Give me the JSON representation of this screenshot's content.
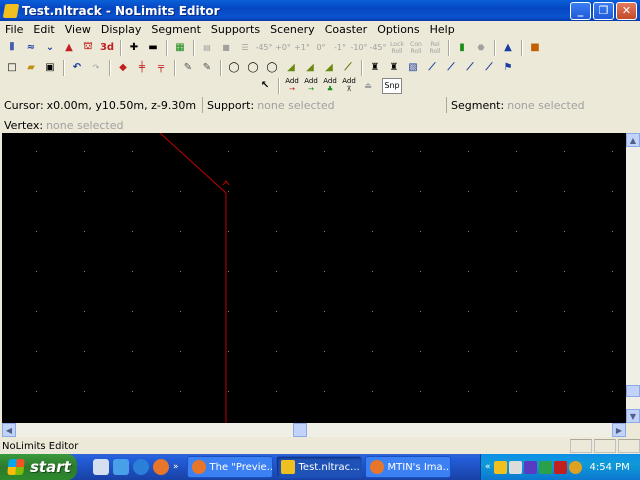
{
  "window": {
    "title": "Test.nltrack - NoLimits Editor",
    "min_label": "_",
    "max_label": "❐",
    "close_label": "✕"
  },
  "menu": [
    "File",
    "Edit",
    "View",
    "Display",
    "Segment",
    "Supports",
    "Scenery",
    "Coaster",
    "Options",
    "Help"
  ],
  "toolbar": {
    "three_d": "3d",
    "dimmed": [
      "-45°",
      "+0°",
      "+1°",
      "0°",
      "-1°",
      "-10°",
      "-45°"
    ],
    "roll_labels": [
      "Lock Roll",
      "Con Roll",
      "Rel Roll"
    ],
    "add_labels": [
      "Add",
      "Add",
      "Add",
      "Add"
    ],
    "snap": "Snp"
  },
  "status": {
    "cursor_label": "Cursor:",
    "cursor_value": "x0.00m, y10.50m, z-9.30m",
    "support_label": "Support:",
    "support_value": "none selected",
    "segment_label": "Segment:",
    "segment_value": "none selected",
    "vertex_label": "Vertex:",
    "vertex_value": "none selected"
  },
  "bottom_status": {
    "text": "NoLimits Editor"
  },
  "taskbar": {
    "start_label": "start",
    "tasks": [
      {
        "label": "The \"Previe...",
        "active": false
      },
      {
        "label": "Test.nltrac...",
        "active": true
      },
      {
        "label": "MTIN's Ima...",
        "active": false
      }
    ],
    "clock": "4:54 PM"
  },
  "colors": {
    "viewport_bg": "#000000",
    "grid_dot": "#808080",
    "track_line": "#c00000",
    "titlebar": "#0a5fd8",
    "taskbar": "#245edb"
  }
}
